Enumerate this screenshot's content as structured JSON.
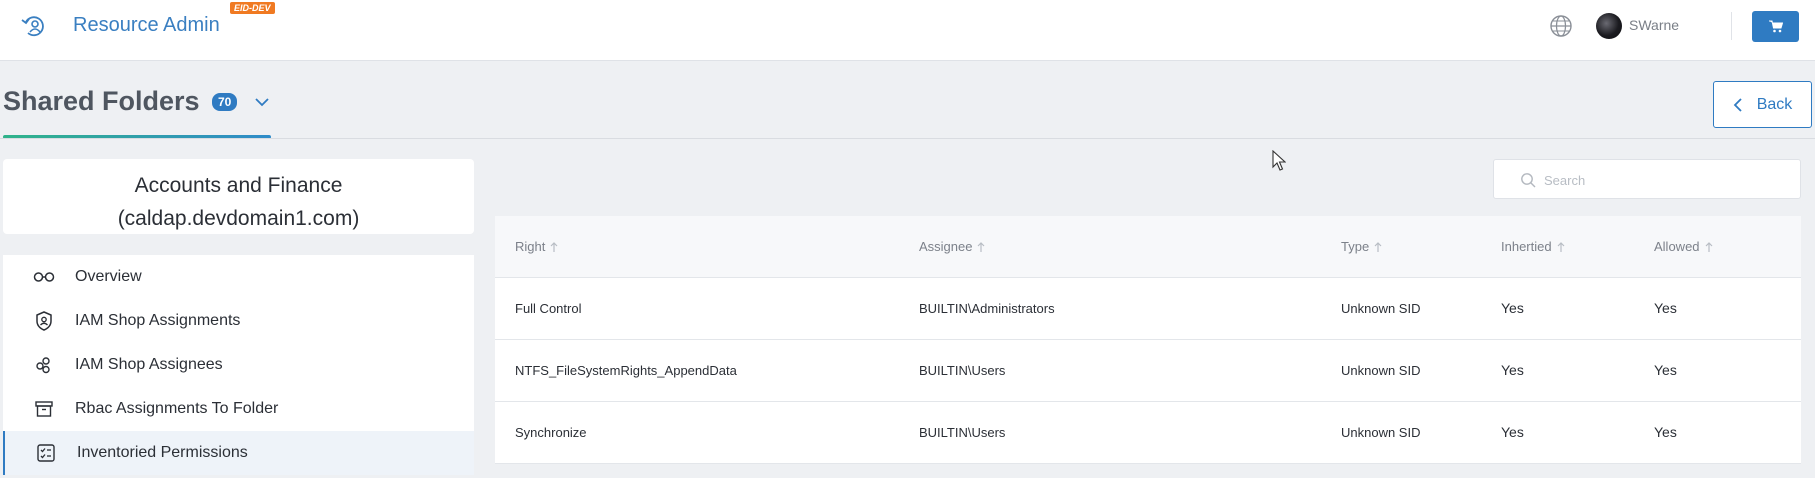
{
  "header": {
    "app_title": "Resource Admin",
    "env_badge": "EID-DEV",
    "user_name": "SWarne",
    "icons": {
      "logo": "refresh-user-icon",
      "globe": "globe-icon",
      "cart": "cart-icon"
    },
    "brand_color": "#2f7bc2",
    "badge_color": "#f07a22"
  },
  "page": {
    "title": "Shared Folders",
    "count": "70",
    "back_label": "Back"
  },
  "entity": {
    "line1": "Accounts and Finance",
    "line2": "(caldap.devdomain1.com)"
  },
  "nav": {
    "items": [
      {
        "label": "Overview",
        "icon": "glasses-icon",
        "active": false
      },
      {
        "label": "IAM Shop Assignments",
        "icon": "shield-user-icon",
        "active": false
      },
      {
        "label": "IAM Shop Assignees",
        "icon": "users-icon",
        "active": false
      },
      {
        "label": "Rbac Assignments To Folder",
        "icon": "archive-box-icon",
        "active": false
      },
      {
        "label": "Inventoried Permissions",
        "icon": "checklist-icon",
        "active": true
      }
    ]
  },
  "search": {
    "placeholder": "Search",
    "value": ""
  },
  "table": {
    "columns": [
      "Right",
      "Assignee",
      "Type",
      "Inhertied",
      "Allowed"
    ],
    "rows": [
      [
        "Full Control",
        "BUILTIN\\Administrators",
        "Unknown SID",
        "Yes",
        "Yes"
      ],
      [
        "NTFS_FileSystemRights_AppendData",
        "BUILTIN\\Users",
        "Unknown SID",
        "Yes",
        "Yes"
      ],
      [
        "Synchronize",
        "BUILTIN\\Users",
        "Unknown SID",
        "Yes",
        "Yes"
      ]
    ]
  }
}
